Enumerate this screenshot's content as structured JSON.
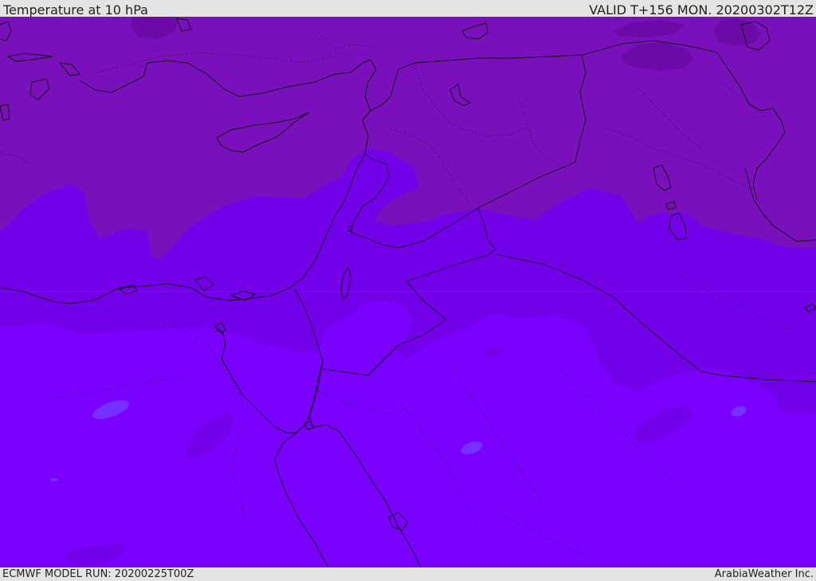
{
  "header": {
    "title": "Temperature at 10 hPa",
    "valid": "VALID T+156 MON. 20200302T12Z"
  },
  "footer": {
    "model_run": "ECMWF MODEL RUN: 20200225T00Z",
    "credit": "ArabiaWeather Inc."
  },
  "colors": {
    "band_cold": "#7a00ff",
    "band_mid": "#7400ea",
    "band_warm": "#7a10bc",
    "band_warmest": "#6c0aa8",
    "band_cool_spot": "#7630ff",
    "coastline": "#111111"
  }
}
